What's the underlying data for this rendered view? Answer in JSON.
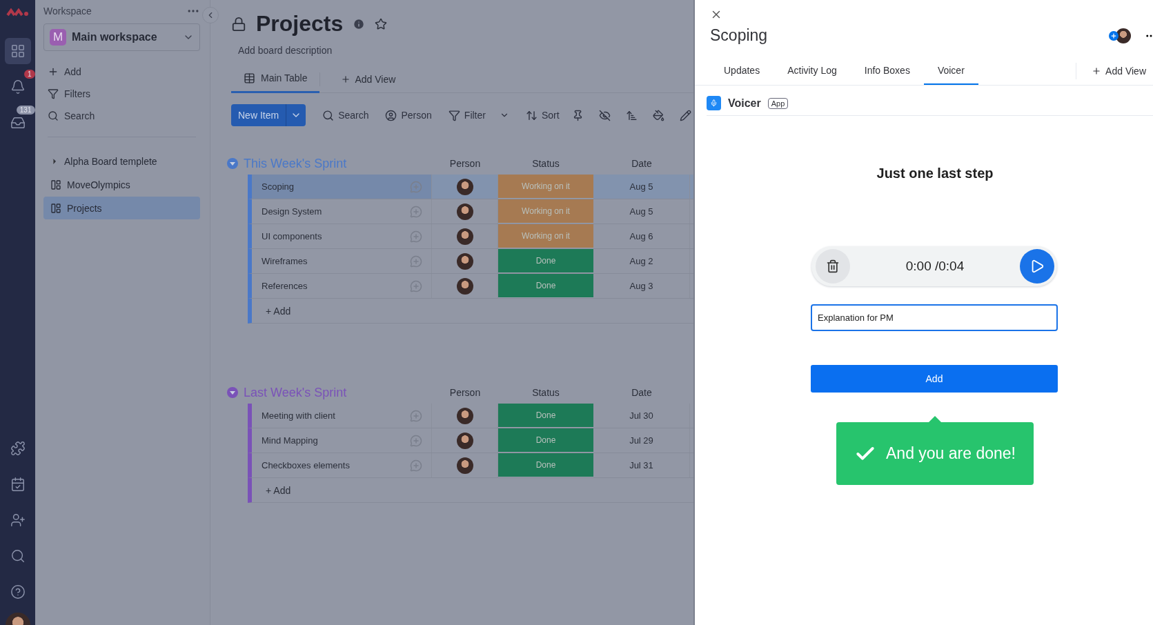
{
  "rail": {
    "notifications_badge": "1",
    "inbox_badge": "131"
  },
  "sidebar": {
    "label": "Workspace",
    "workspace": {
      "initial": "M",
      "name": "Main workspace"
    },
    "actions": [
      {
        "kind": "add",
        "label": "Add"
      },
      {
        "kind": "filter",
        "label": "Filters"
      },
      {
        "kind": "search",
        "label": "Search"
      }
    ],
    "boards": [
      {
        "kind": "folder",
        "name": "Alpha Board templete",
        "selected": false
      },
      {
        "kind": "shared",
        "name": "MoveOlympics",
        "selected": false
      },
      {
        "kind": "private",
        "name": "Projects",
        "selected": true
      }
    ]
  },
  "board": {
    "title": "Projects",
    "description": "Add board description",
    "views": [
      {
        "label": "Main Table",
        "selected": true
      }
    ],
    "add_view": "Add View",
    "new_item": "New Item",
    "tools": [
      {
        "kind": "search",
        "label": "Search"
      },
      {
        "kind": "person",
        "label": "Person"
      },
      {
        "kind": "filter",
        "label": "Filter"
      },
      {
        "kind": "sort",
        "label": "Sort"
      }
    ],
    "groups": [
      {
        "title": "This Week's Sprint",
        "color": "#4a78c8",
        "columns": [
          "Person",
          "Status",
          "Date"
        ],
        "add": "+ Add",
        "rows": [
          {
            "name": "Scoping",
            "status": "Working on it",
            "color": "#a67a52",
            "date": "Aug 5",
            "selected": true
          },
          {
            "name": "Design System",
            "status": "Working on it",
            "color": "#a67a52",
            "date": "Aug 5",
            "selected": false
          },
          {
            "name": "UI components",
            "status": "Working on it",
            "color": "#a67a52",
            "date": "Aug 6",
            "selected": false
          },
          {
            "name": "Wireframes",
            "status": "Done",
            "color": "#1d7a57",
            "date": "Aug 2",
            "selected": false
          },
          {
            "name": "References",
            "status": "Done",
            "color": "#1d7a57",
            "date": "Aug 3",
            "selected": false
          }
        ]
      },
      {
        "title": "Last Week's Sprint",
        "color": "#7a52b8",
        "columns": [
          "Person",
          "Status",
          "Date"
        ],
        "add": "+ Add",
        "rows": [
          {
            "name": "Meeting with client",
            "status": "Done",
            "color": "#1d7a57",
            "date": "Jul 30",
            "selected": false
          },
          {
            "name": "Mind Mapping",
            "status": "Done",
            "color": "#1d7a57",
            "date": "Jul 29",
            "selected": false
          },
          {
            "name": "Checkboxes elements",
            "status": "Done",
            "color": "#1d7a57",
            "date": "Jul 31",
            "selected": false
          }
        ]
      }
    ]
  },
  "panel": {
    "title": "Scoping",
    "tabs": [
      {
        "label": "Updates",
        "selected": false
      },
      {
        "label": "Activity Log",
        "selected": false
      },
      {
        "label": "Info Boxes",
        "selected": false
      },
      {
        "label": "Voicer",
        "selected": true
      }
    ],
    "add_view": "Add View",
    "app": {
      "name": "Voicer",
      "badge": "App"
    },
    "heading": "Just one last step",
    "player": {
      "time": "0:00 /0:04"
    },
    "input": {
      "value": "Explanation for PM"
    },
    "button": "Add",
    "toast": "And you are done!"
  }
}
